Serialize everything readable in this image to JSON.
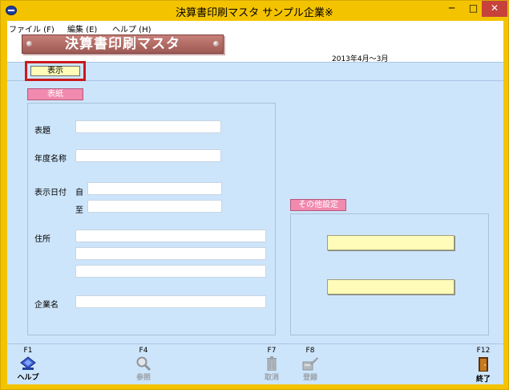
{
  "window": {
    "title": "決算書印刷マスタ サンプル企業※",
    "minimize": "─",
    "maximize": "□",
    "close": "✕"
  },
  "menu": [
    {
      "label": "ファイル (F)"
    },
    {
      "label": "編集 (E)"
    },
    {
      "label": "ヘルプ (H)"
    }
  ],
  "header": {
    "banner": "決算書印刷マスタ",
    "period": "2013年4月～3月"
  },
  "toolbar": {
    "display_label": "表示"
  },
  "cover": {
    "tab": "表紙",
    "title_label": "表題",
    "title_value": "",
    "fiscal_name_label": "年度名称",
    "fiscal_name_value": "",
    "display_date_label": "表示日付",
    "from_label": "自",
    "from_value": "",
    "to_label": "至",
    "to_value": "",
    "address_label": "住所",
    "address_line1": "",
    "address_line2": "",
    "address_line3": "",
    "company_label": "企業名",
    "company_value": ""
  },
  "other": {
    "tab": "その他設定",
    "button1": "",
    "button2": ""
  },
  "fkeys": [
    {
      "key": "F1",
      "label": "ヘルプ",
      "icon": "help-book-icon",
      "enabled": true
    },
    {
      "key": "F4",
      "label": "参照",
      "icon": "magnifier-icon",
      "enabled": false
    },
    {
      "key": "F7",
      "label": "取消",
      "icon": "trash-icon",
      "enabled": false
    },
    {
      "key": "F8",
      "label": "登録",
      "icon": "register-icon",
      "enabled": false
    },
    {
      "key": "F12",
      "label": "終了",
      "icon": "exit-door-icon",
      "enabled": true
    }
  ],
  "colors": {
    "titlebar": "#f4c300",
    "client": "#cde5fb",
    "banner": "#b06c66",
    "tab": "#f08aae",
    "focus": "#c91a1a",
    "yellow_button": "#fffbb8"
  }
}
